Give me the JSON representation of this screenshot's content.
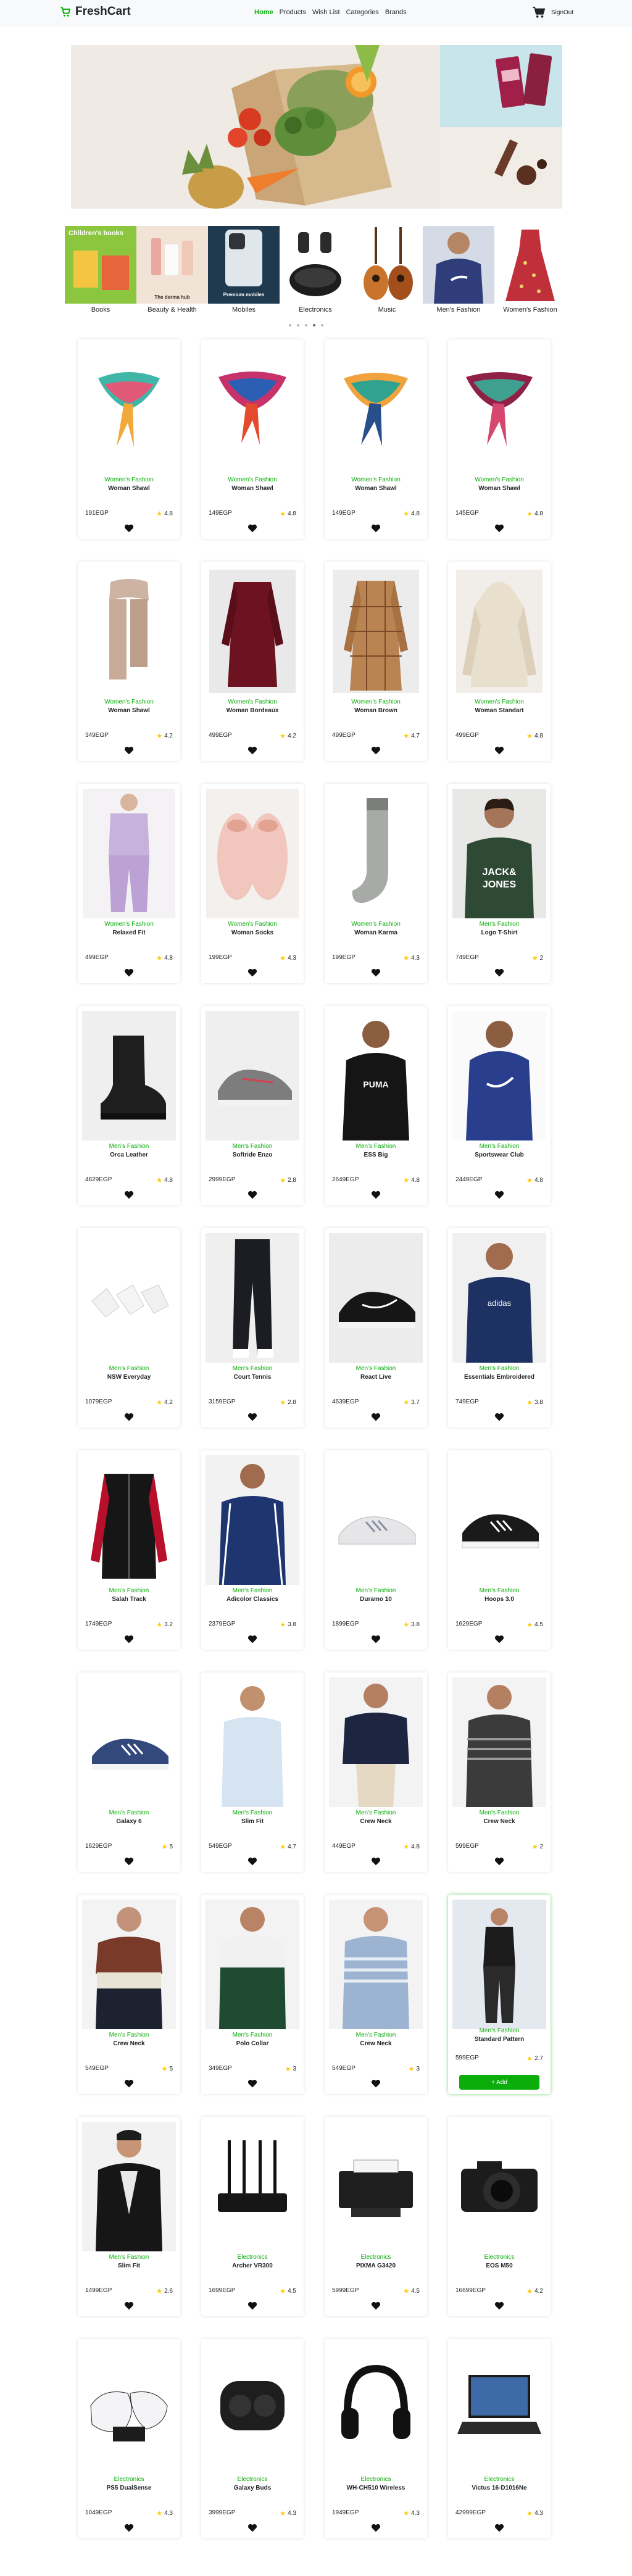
{
  "nav": {
    "brand": "FreshCart",
    "links": [
      "Home",
      "Products",
      "Wish List",
      "Categories",
      "Brands"
    ],
    "active": "Home",
    "signout": "SignOut",
    "accent": "#0aad0a"
  },
  "categories": [
    {
      "label": "Books",
      "img_text": "Children's books"
    },
    {
      "label": "Beauty & Health",
      "img_text": "The derma hub"
    },
    {
      "label": "Mobiles",
      "img_text": "Premium mobiles"
    },
    {
      "label": "Electronics"
    },
    {
      "label": "Music"
    },
    {
      "label": "Men's Fashion"
    },
    {
      "label": "Women's Fashion"
    }
  ],
  "slider_dots": 5,
  "slider_active_dot": 3,
  "products": [
    {
      "category": "Women's Fashion",
      "name": "Woman Shawl",
      "price": "191EGP",
      "rating": "4.8",
      "img": "scarf1"
    },
    {
      "category": "Women's Fashion",
      "name": "Woman Shawl",
      "price": "149EGP",
      "rating": "4.8",
      "img": "scarf2"
    },
    {
      "category": "Women's Fashion",
      "name": "Woman Shawl",
      "price": "149EGP",
      "rating": "4.8",
      "img": "scarf3"
    },
    {
      "category": "Women's Fashion",
      "name": "Woman Shawl",
      "price": "145EGP",
      "rating": "4.8",
      "img": "scarf4"
    },
    {
      "category": "Women's Fashion",
      "name": "Woman Shawl",
      "price": "349EGP",
      "rating": "4.2",
      "img": "knit-scarf"
    },
    {
      "category": "Women's Fashion",
      "name": "Woman Bordeaux",
      "price": "499EGP",
      "rating": "4.2",
      "img": "red-shirt"
    },
    {
      "category": "Women's Fashion",
      "name": "Woman Brown",
      "price": "499EGP",
      "rating": "4.7",
      "img": "plaid-shirt"
    },
    {
      "category": "Women's Fashion",
      "name": "Woman Standart",
      "price": "499EGP",
      "rating": "4.8",
      "img": "hoodie-cream"
    },
    {
      "category": "Women's Fashion",
      "name": "Relaxed Fit",
      "price": "499EGP",
      "rating": "4.8",
      "img": "lilac-set"
    },
    {
      "category": "Women's Fashion",
      "name": "Woman Socks",
      "price": "199EGP",
      "rating": "4.3",
      "img": "slippers"
    },
    {
      "category": "Women's Fashion",
      "name": "Woman Karma",
      "price": "199EGP",
      "rating": "4.3",
      "img": "sock"
    },
    {
      "category": "Men's Fashion",
      "name": "Logo T-Shirt",
      "price": "749EGP",
      "rating": "2",
      "img": "jj-tee"
    },
    {
      "category": "Men's Fashion",
      "name": "Orca Leather",
      "price": "4829EGP",
      "rating": "4.8",
      "img": "boot"
    },
    {
      "category": "Men's Fashion",
      "name": "Softride Enzo",
      "price": "2999EGP",
      "rating": "2.8",
      "img": "sneaker-grey"
    },
    {
      "category": "Men's Fashion",
      "name": "ESS Big",
      "price": "2649EGP",
      "rating": "4.8",
      "img": "puma-hoodie"
    },
    {
      "category": "Men's Fashion",
      "name": "Sportswear Club",
      "price": "2449EGP",
      "rating": "4.8",
      "img": "nike-hoodie"
    },
    {
      "category": "Men's Fashion",
      "name": "NSW Everyday",
      "price": "1079EGP",
      "rating": "4.2",
      "img": "socks-white"
    },
    {
      "category": "Men's Fashion",
      "name": "Court Tennis",
      "price": "3159EGP",
      "rating": "2.8",
      "img": "track-pants"
    },
    {
      "category": "Men's Fashion",
      "name": "React Live",
      "price": "4639EGP",
      "rating": "3.7",
      "img": "sneaker-black"
    },
    {
      "category": "Men's Fashion",
      "name": "Essentials Embroidered",
      "price": "749EGP",
      "rating": "3.8",
      "img": "adidas-tee"
    },
    {
      "category": "Men's Fashion",
      "name": "Salah Track",
      "price": "1749EGP",
      "rating": "3.2",
      "img": "track-jacket"
    },
    {
      "category": "Men's Fashion",
      "name": "Adicolor Classics",
      "price": "2379EGP",
      "rating": "3.8",
      "img": "navy-jacket"
    },
    {
      "category": "Men's Fashion",
      "name": "Duramo 10",
      "price": "1899EGP",
      "rating": "3.8",
      "img": "sneaker-white"
    },
    {
      "category": "Men's Fashion",
      "name": "Hoops 3.0",
      "price": "1629EGP",
      "rating": "4.5",
      "img": "sneaker-bw"
    },
    {
      "category": "Men's Fashion",
      "name": "Galaxy 6",
      "price": "1629EGP",
      "rating": "5",
      "img": "sneaker-blue"
    },
    {
      "category": "Men's Fashion",
      "name": "Slim Fit",
      "price": "549EGP",
      "rating": "4.7",
      "img": "white-shirt"
    },
    {
      "category": "Men's Fashion",
      "name": "Crew Neck",
      "price": "449EGP",
      "rating": "4.8",
      "img": "navy-sweater"
    },
    {
      "category": "Men's Fashion",
      "name": "Crew Neck",
      "price": "599EGP",
      "rating": "2",
      "img": "stripe-sweater"
    },
    {
      "category": "Men's Fashion",
      "name": "Crew Neck",
      "price": "549EGP",
      "rating": "5",
      "img": "colorblock"
    },
    {
      "category": "Men's Fashion",
      "name": "Polo Collar",
      "price": "349EGP",
      "rating": "3",
      "img": "polo-green"
    },
    {
      "category": "Men's Fashion",
      "name": "Crew Neck",
      "price": "549EGP",
      "rating": "3",
      "img": "blue-stripe"
    },
    {
      "category": "Men's Fashion",
      "name": "Standard Pattern",
      "price": "599EGP",
      "rating": "2.7",
      "img": "black-set",
      "hovered": true
    },
    {
      "category": "Men's Fashion",
      "name": "Slim Fit",
      "price": "1499EGP",
      "rating": "2.6",
      "img": "leather-jacket"
    },
    {
      "category": "Electronics",
      "name": "Archer VR300",
      "price": "1699EGP",
      "rating": "4.5",
      "img": "router"
    },
    {
      "category": "Electronics",
      "name": "PIXMA G3420",
      "price": "5999EGP",
      "rating": "4.5",
      "img": "printer"
    },
    {
      "category": "Electronics",
      "name": "EOS M50",
      "price": "16699EGP",
      "rating": "4.2",
      "img": "camera"
    },
    {
      "category": "Electronics",
      "name": "PS5 DualSense",
      "price": "1049EGP",
      "rating": "4.3",
      "img": "controllers"
    },
    {
      "category": "Electronics",
      "name": "Galaxy Buds",
      "price": "3999EGP",
      "rating": "4.3",
      "img": "buds"
    },
    {
      "category": "Electronics",
      "name": "WH-CH510 Wireless",
      "price": "1949EGP",
      "rating": "4.3",
      "img": "headphones"
    },
    {
      "category": "Electronics",
      "name": "Victus 16-D1016Ne",
      "price": "42999EGP",
      "rating": "4.3",
      "img": "laptop"
    }
  ],
  "add_button_label": "+ Add"
}
